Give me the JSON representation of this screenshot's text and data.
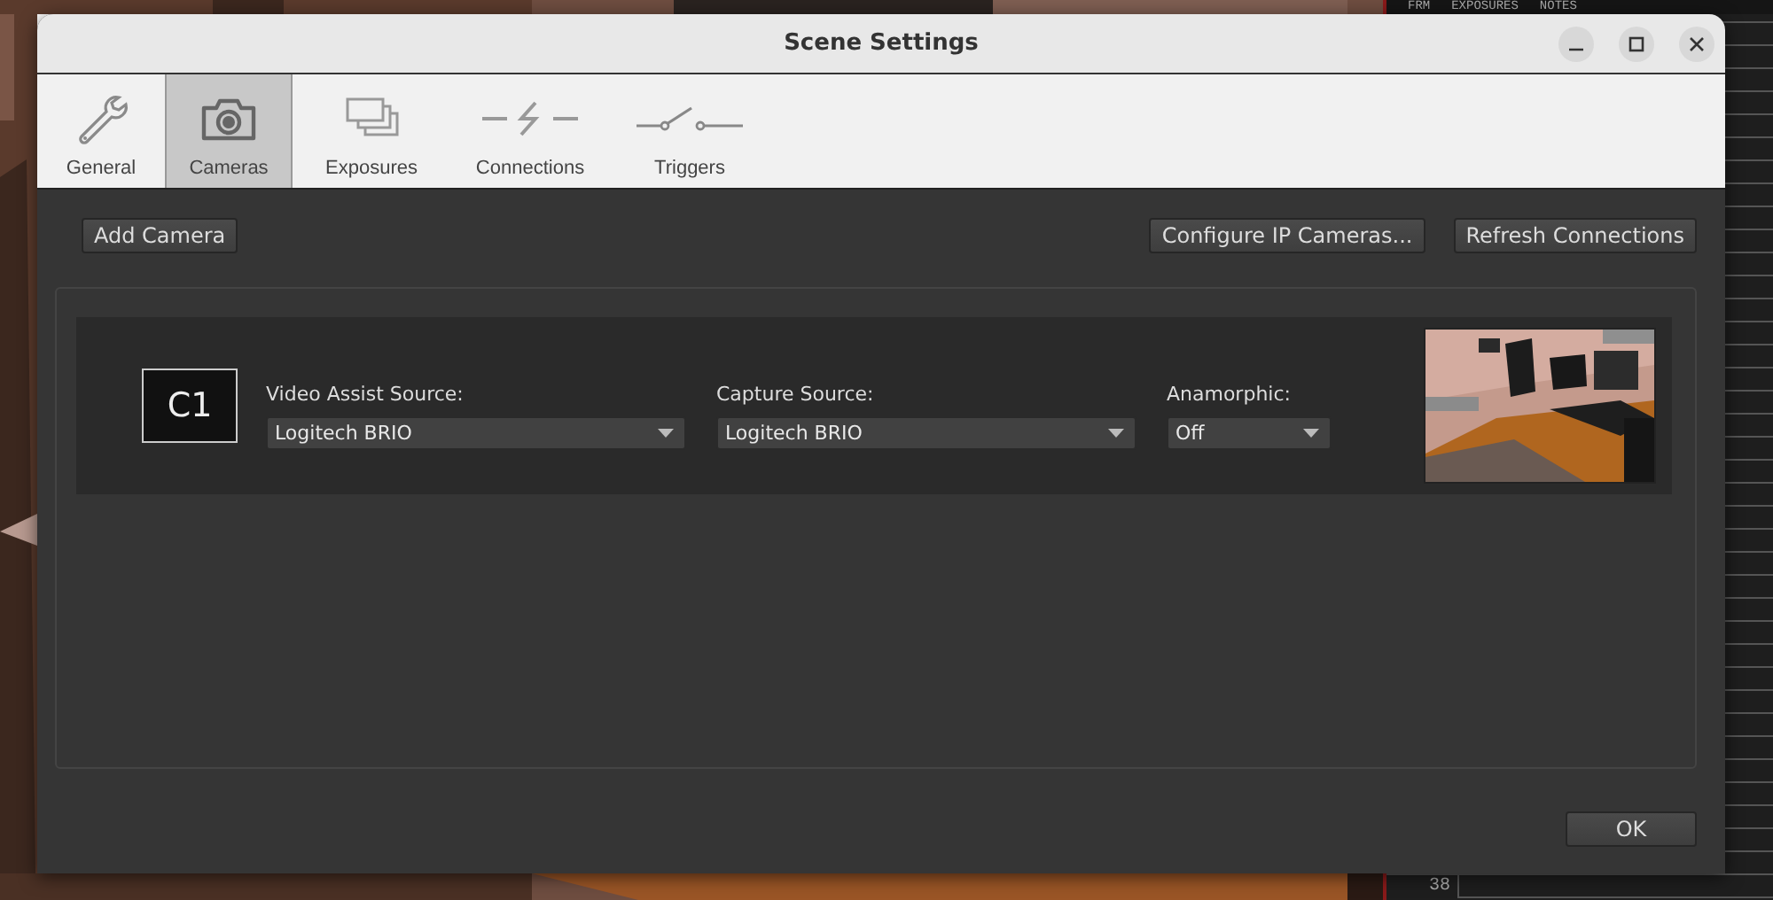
{
  "background": {
    "columns": [
      "FRM",
      "EXPOSURES",
      "NOTES"
    ],
    "row_numbers": [
      "38"
    ]
  },
  "window": {
    "title": "Scene Settings",
    "controls": [
      {
        "kind": "minimize"
      },
      {
        "kind": "maximize"
      },
      {
        "kind": "close"
      }
    ]
  },
  "tabs": [
    {
      "label": "General",
      "kind": "wrench",
      "selected": false
    },
    {
      "label": "Cameras",
      "kind": "camera",
      "selected": true
    },
    {
      "label": "Exposures",
      "kind": "frames",
      "selected": false
    },
    {
      "label": "Connections",
      "kind": "bolt",
      "selected": false
    },
    {
      "label": "Triggers",
      "kind": "switch",
      "selected": false
    }
  ],
  "toolbar": {
    "left": [
      "Add Camera"
    ],
    "right": [
      "Configure IP Cameras...",
      "Refresh Connections"
    ]
  },
  "cameras": [
    {
      "badge": "C1",
      "fields": [
        {
          "label": "Video Assist Source:",
          "value": "Logitech BRIO"
        },
        {
          "label": "Capture Source:",
          "value": "Logitech BRIO"
        },
        {
          "label": "Anamorphic:",
          "value": "Off"
        }
      ]
    }
  ],
  "buttons": [
    "OK"
  ]
}
